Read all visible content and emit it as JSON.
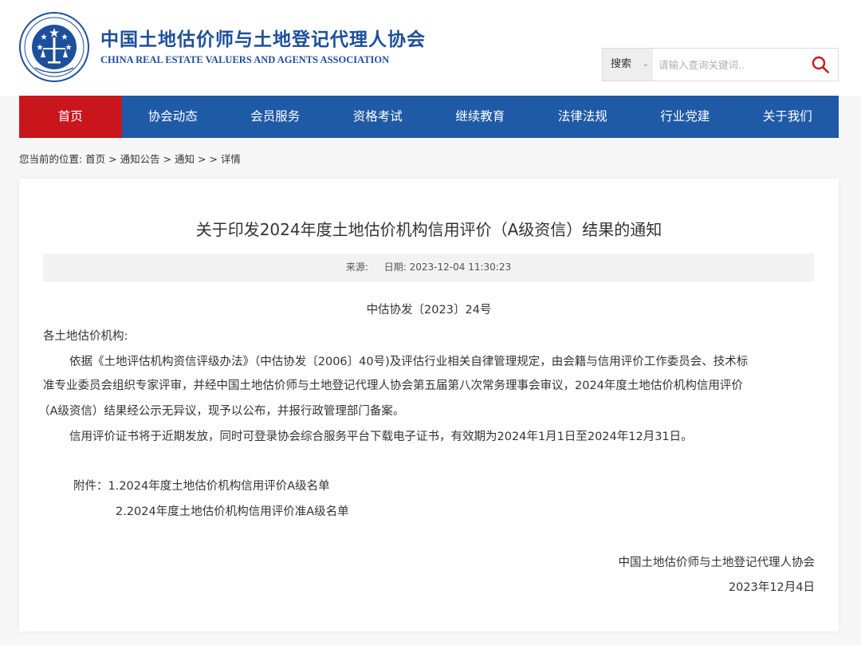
{
  "header": {
    "title_cn": "中国土地估价师与土地登记代理人协会",
    "title_en": "CHINA REAL ESTATE VALUERS AND AGENTS ASSOCIATION",
    "logo_icon": "association-emblem-icon"
  },
  "search": {
    "type_label": "搜索",
    "placeholder": "请输入查询关键词..",
    "value": "",
    "button_icon": "search-icon",
    "icon_color": "#c9161d"
  },
  "nav": {
    "items": [
      {
        "label": "首页",
        "active": true
      },
      {
        "label": "协会动态"
      },
      {
        "label": "会员服务"
      },
      {
        "label": "资格考试"
      },
      {
        "label": "继续教育"
      },
      {
        "label": "法律法规"
      },
      {
        "label": "行业党建"
      },
      {
        "label": "关于我们"
      }
    ],
    "bg_color": "#1f5aa6",
    "active_color": "#c9161d"
  },
  "breadcrumb": "您当前的位置: 首页 > 通知公告 > 通知 > > 详情",
  "article": {
    "title": "关于印发2024年度土地估价机构信用评价（A级资信）结果的通知",
    "source_label": "来源:",
    "date_label": "日期: 2023-12-04 11:30:23",
    "doc_number": "中估协发〔2023〕24号",
    "salutation": "各土地估价机构:",
    "para1_line1": "依据《土地评估机构资信评级办法》（中估协发〔2006〕40号)及评估行业相关自律管理规定，由会籍与信用评价工作委员会、技术标",
    "para1_line2": "准专业委员会组织专家评审，并经中国土地估价师与土地登记代理人协会第五届第八次常务理事会审议，2024年度土地估价机构信用评价",
    "para1_line3": "（A级资信）结果经公示无异议，现予以公布，并报行政管理部门备案。",
    "para2": "信用评价证书将于近期发放，同时可登录协会综合服务平台下载电子证书，有效期为2024年1月1日至2024年12月31日。",
    "attachment1": "附件：1.2024年度土地估价机构信用评价A级名单",
    "attachment2": "2.2024年度土地估价机构信用评价准A级名单",
    "signature_org": "中国土地估价师与土地登记代理人协会",
    "signature_date": "2023年12月4日"
  }
}
